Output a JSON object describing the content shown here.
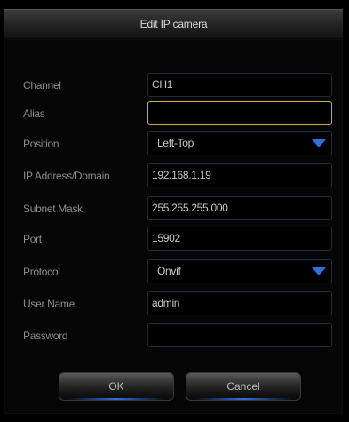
{
  "dialog": {
    "title": "Edit IP camera"
  },
  "fields": {
    "channel": {
      "label": "Channel",
      "value": "CH1"
    },
    "alias": {
      "label": "Alias",
      "value": ""
    },
    "position": {
      "label": "Position",
      "value": "Left-Top"
    },
    "ip_address": {
      "label": "IP Address/Domain",
      "value": "192.168.1.19"
    },
    "subnet_mask": {
      "label": "Subnet Mask",
      "value": "255.255.255.000"
    },
    "port": {
      "label": "Port",
      "value": "15902"
    },
    "protocol": {
      "label": "Protocol",
      "value": "Onvif"
    },
    "user_name": {
      "label": "User Name",
      "value": "admin"
    },
    "password": {
      "label": "Password",
      "value": ""
    }
  },
  "buttons": {
    "ok_label": "OK",
    "cancel_label": "Cancel"
  },
  "icons": {
    "dropdown": "chevron-down-icon"
  },
  "colors": {
    "dropdown_arrow": "#2f6fe0",
    "focus_border": "#c9b22a",
    "field_border": "#1d2a44",
    "label_text": "#8c8c8c"
  }
}
